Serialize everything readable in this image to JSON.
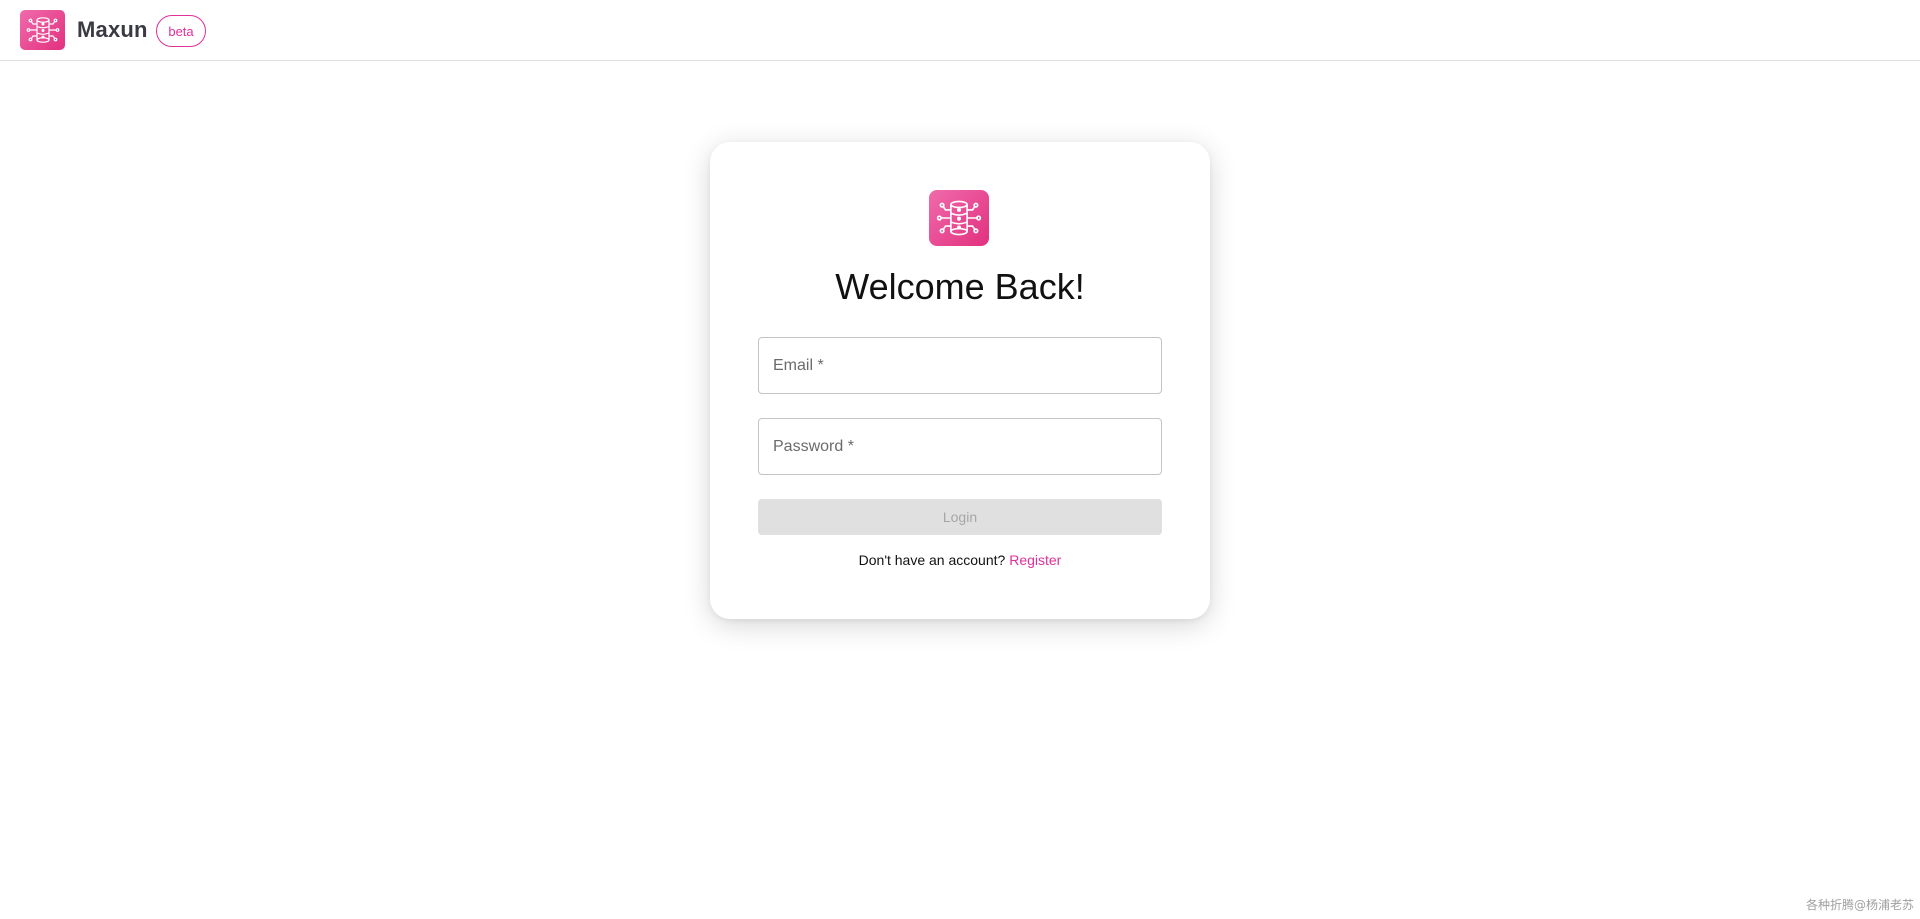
{
  "header": {
    "brand_name": "Maxun",
    "badge": "beta",
    "logo_icon": "database-network-icon"
  },
  "login_card": {
    "logo_icon": "database-network-icon",
    "title": "Welcome Back!",
    "email_placeholder": "Email *",
    "email_value": "",
    "password_placeholder": "Password *",
    "password_value": "",
    "login_label": "Login",
    "prompt_text": "Don't have an account?",
    "register_label": "Register"
  },
  "watermark": "各种折腾@杨浦老苏",
  "colors": {
    "accent": "#e0309a",
    "logo_gradient_start": "#f06bab",
    "logo_gradient_end": "#e2307f",
    "disabled_button_bg": "#e0e0e0",
    "disabled_button_text": "#a6a6a6"
  }
}
